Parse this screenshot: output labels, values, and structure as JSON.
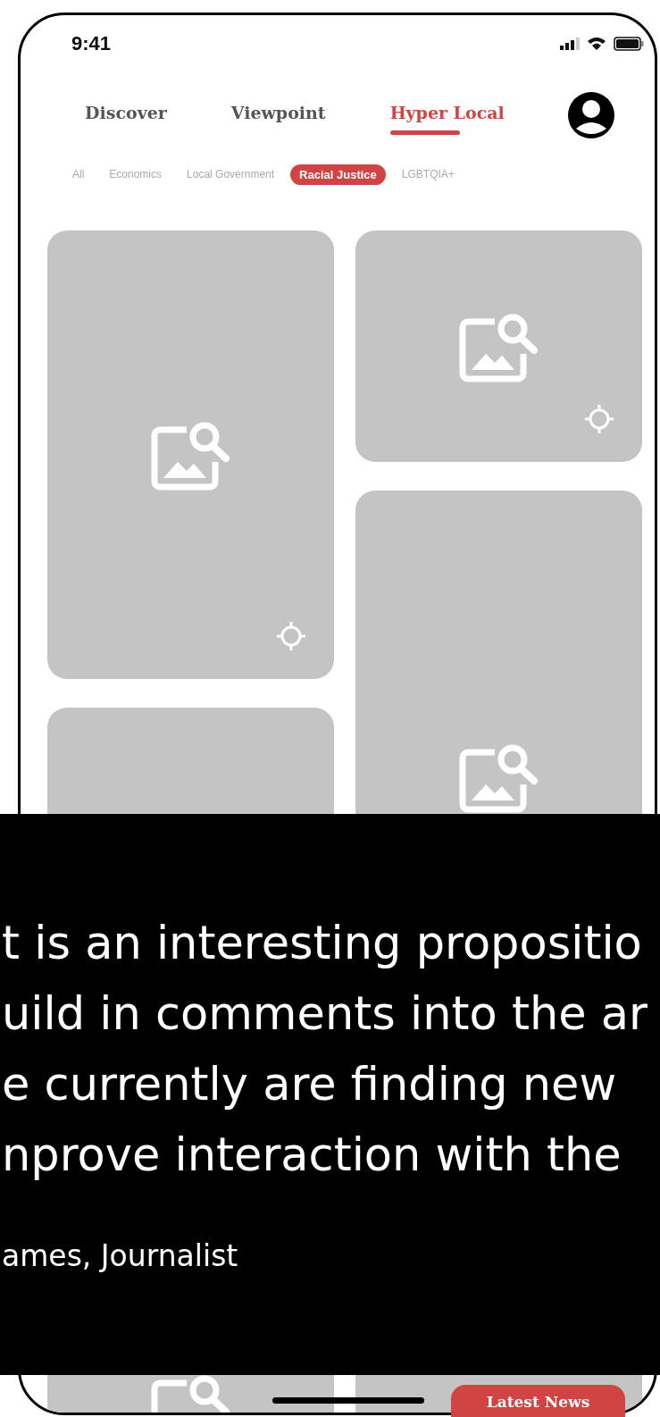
{
  "status_bar": {
    "time": "9:41"
  },
  "tabs": [
    {
      "label": "Discover",
      "selected": false
    },
    {
      "label": "Viewpoint",
      "selected": false
    },
    {
      "label": "Hyper Local",
      "selected": true
    }
  ],
  "filters": [
    {
      "label": "All",
      "selected": false
    },
    {
      "label": "Economics",
      "selected": false
    },
    {
      "label": "Local Government",
      "selected": false
    },
    {
      "label": "Racial Justice",
      "selected": true
    },
    {
      "label": "LGBTQIA+",
      "selected": false
    }
  ],
  "quote": {
    "lines": [
      "t is an interesting propositio",
      "uild in comments into the ar",
      "e currently are finding new",
      "nprove interaction with the"
    ],
    "author": "ames, Journalist"
  },
  "latest_news_button": "Latest News"
}
